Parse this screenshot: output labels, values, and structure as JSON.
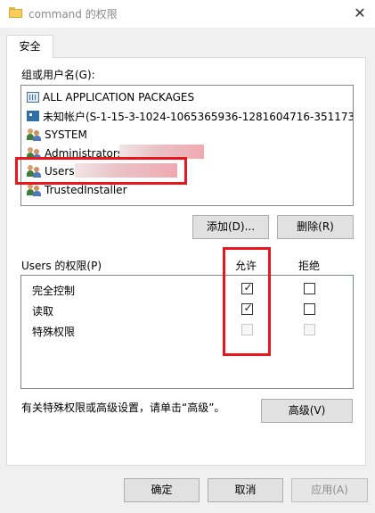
{
  "window": {
    "title": "command 的权限",
    "close_glyph": "✕"
  },
  "tab": {
    "label": "安全"
  },
  "groups": {
    "label": "组或用户名(G):",
    "items": [
      {
        "icon": "app-packages-icon",
        "label": "ALL APPLICATION PACKAGES"
      },
      {
        "icon": "unknown-account-icon",
        "label": "未知帐户(S-1-15-3-1024-1065365936-1281604716-351173..."
      },
      {
        "icon": "users-group-icon",
        "label": "SYSTEM"
      },
      {
        "icon": "users-group-icon",
        "label": "Administrators"
      },
      {
        "icon": "users-group-icon",
        "label": "Users"
      },
      {
        "icon": "users-group-icon",
        "label": "TrustedInstaller"
      }
    ]
  },
  "buttons": {
    "add": "添加(D)...",
    "remove": "删除(R)",
    "advanced": "高级(V)",
    "ok": "确定",
    "cancel": "取消",
    "apply": "应用(A)"
  },
  "permissions": {
    "label": "Users 的权限(P)",
    "allow_header": "允许",
    "deny_header": "拒绝",
    "rows": [
      {
        "label": "完全控制",
        "allow": true,
        "deny": false,
        "enabled": true
      },
      {
        "label": "读取",
        "allow": true,
        "deny": false,
        "enabled": true
      },
      {
        "label": "特殊权限",
        "allow": false,
        "deny": false,
        "enabled": false
      }
    ]
  },
  "advanced_note": "有关特殊权限或高级设置，请单击“高级”。",
  "colors": {
    "annotation": "#e8161e",
    "redaction": "#f0a9b0"
  }
}
